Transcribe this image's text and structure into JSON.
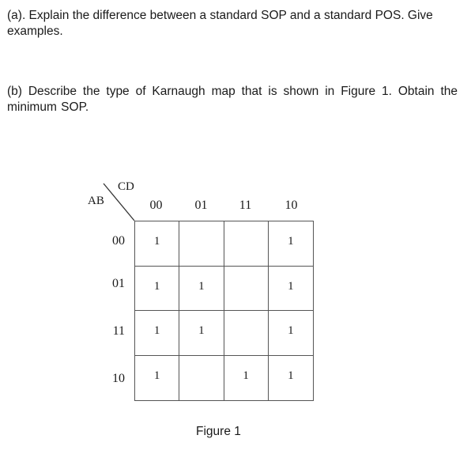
{
  "questions": {
    "a": "(a). Explain the difference between a standard SOP and a standard POS. Give examples.",
    "b": "(b) Describe the type of Karnaugh map that is shown in Figure 1.  Obtain the minimum SOP."
  },
  "kmap": {
    "row_var": "AB",
    "col_var": "CD",
    "col_labels": [
      "00",
      "01",
      "11",
      "10"
    ],
    "row_labels": [
      "00",
      "01",
      "11",
      "10"
    ],
    "cells": [
      [
        "1",
        "",
        "",
        "1"
      ],
      [
        "1",
        "1",
        "",
        "1"
      ],
      [
        "1",
        "1",
        "",
        "1"
      ],
      [
        "1",
        "",
        "1",
        "1"
      ]
    ]
  },
  "figure_caption": "Figure 1"
}
